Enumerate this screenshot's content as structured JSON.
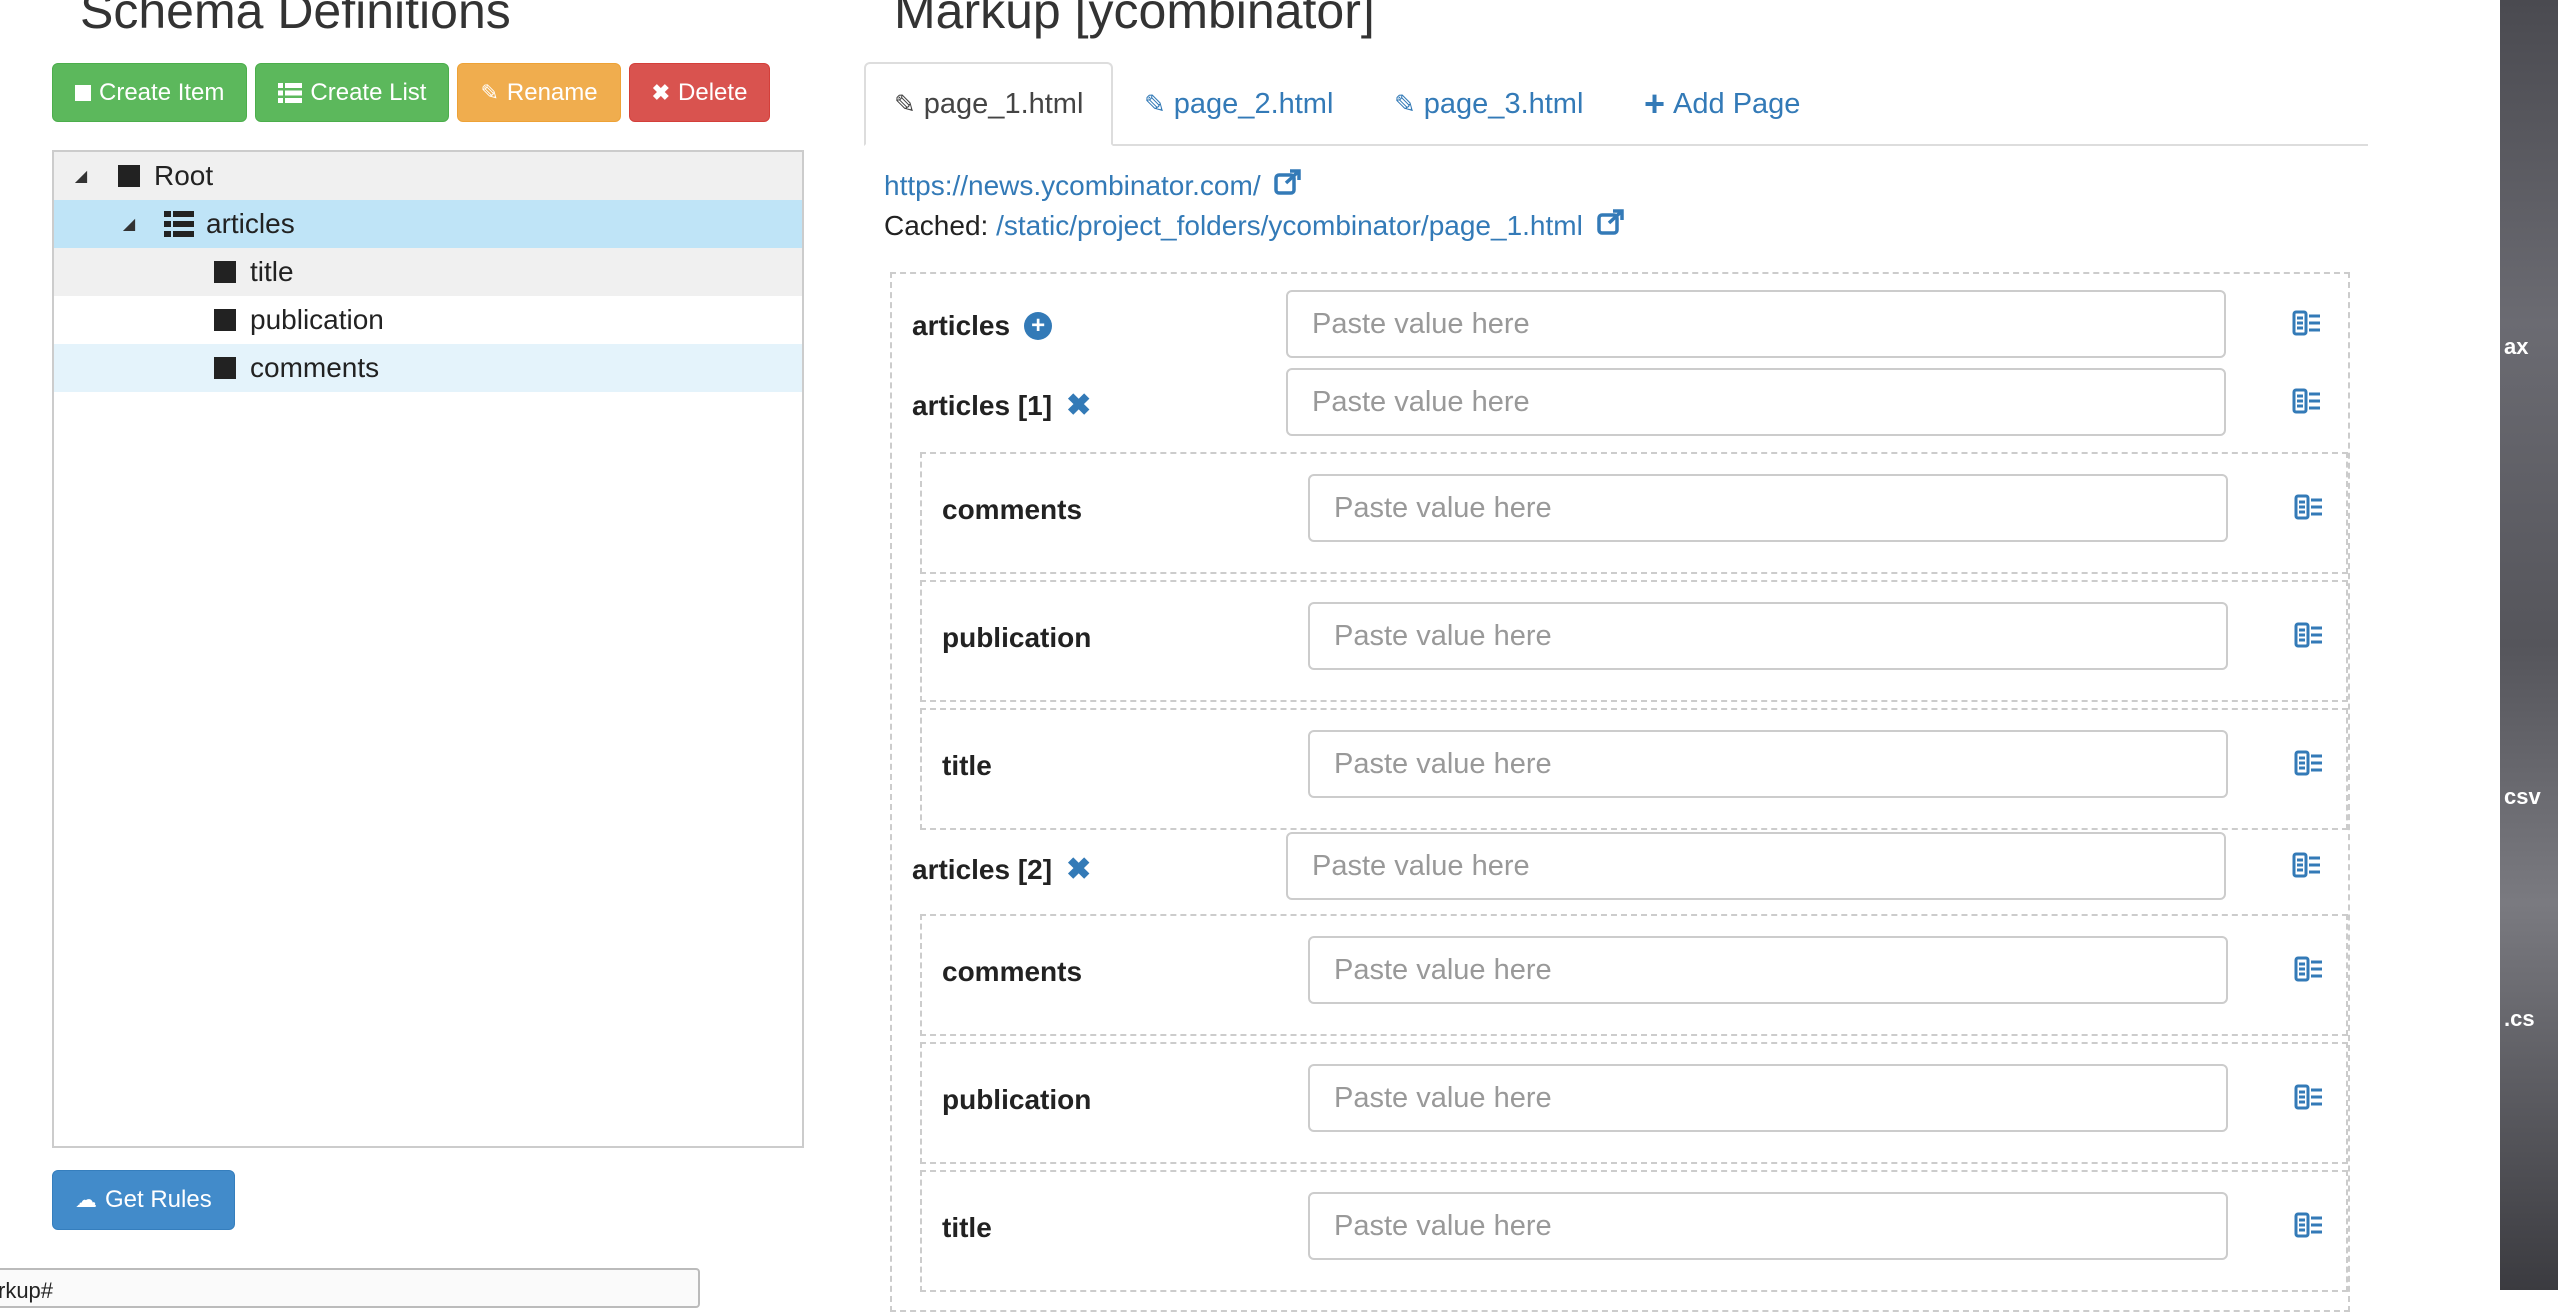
{
  "schema": {
    "title": "Schema Definitions",
    "buttons": {
      "create_item": "Create Item",
      "create_list": "Create List",
      "rename": "Rename",
      "delete": "Delete"
    },
    "tree": {
      "root": "Root",
      "articles": "articles",
      "title": "title",
      "publication": "publication",
      "comments": "comments"
    },
    "get_rules": "Get Rules",
    "bottom_text": "rkup#"
  },
  "markup": {
    "title": "Markup [ycombinator]",
    "tabs": [
      "page_1.html",
      "page_2.html",
      "page_3.html"
    ],
    "add_page": "Add Page",
    "url": "https://news.ycombinator.com/",
    "cached_label": "Cached:",
    "cached_path": "/static/project_folders/ycombinator/page_1.html",
    "placeholder": "Paste value here",
    "fields": {
      "articles": "articles",
      "articles_1": "articles [1]",
      "articles_2": "articles [2]",
      "comments": "comments",
      "publication": "publication",
      "title": "title"
    }
  },
  "desktop_edge": {
    "labels": [
      "ax",
      "csv",
      ".cs"
    ]
  },
  "colors": {
    "green": "#5cb85c",
    "orange": "#f0ad4e",
    "red": "#d9534f",
    "blue": "#428bca",
    "link": "#337ab7",
    "selected_row": "#bfe4f7"
  }
}
